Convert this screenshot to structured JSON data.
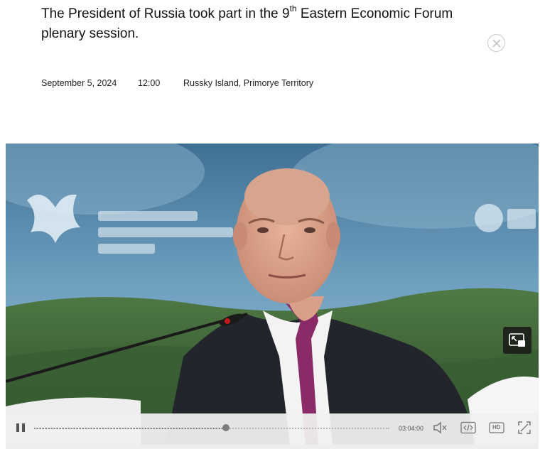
{
  "article": {
    "title_pre": "The President of Russia took part in the 9",
    "title_sup": "th",
    "title_post": " Eastern Economic Forum plenary session.",
    "date": "September 5, 2024",
    "time": "12:00",
    "location": "Russky Island, Primorye Territory"
  },
  "video": {
    "duration": "03:04:00",
    "progress_fraction": 0.54,
    "icons": {
      "close": "close-circle-icon",
      "pip": "picture-in-picture-icon",
      "pause": "pause-icon",
      "volume": "volume-muted-icon",
      "embed": "code-icon",
      "hd": "hd-icon",
      "fullscreen": "fullscreen-icon"
    },
    "hd_label": "HD"
  }
}
